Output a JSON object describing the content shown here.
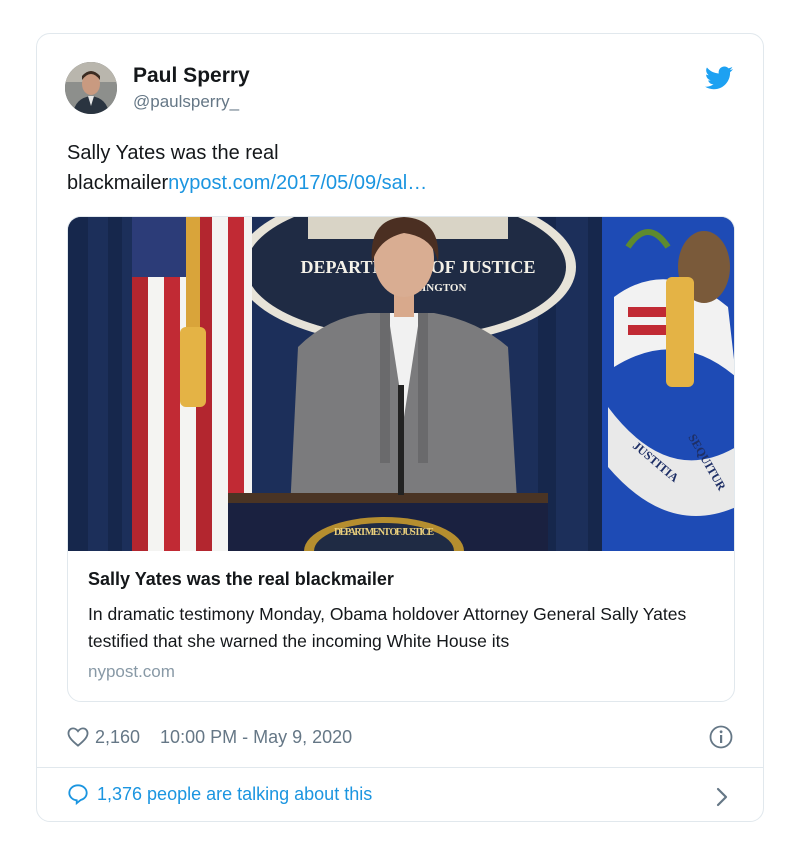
{
  "tweet": {
    "author_name": "Paul Sperry",
    "author_handle": "@paulsperry_",
    "text": "Sally Yates was the real blackmailer",
    "link_text": "nypost.com/2017/05/09/sal…",
    "likes": "2,160",
    "timestamp": "10:00 PM - May 9, 2020",
    "talking": "1,376 people are talking about this"
  },
  "link_card": {
    "title": "Sally Yates was the real blackmailer",
    "description": "In dramatic testimony Monday, Obama holdover Attorney General Sally Yates testified that she warned the incoming White House its",
    "domain": "nypost.com",
    "photo_seal_text": "DEPARTMENT OF JUSTICE",
    "photo_seal_subtext": "WASHINGTON",
    "photo_flag_text_1": "JUSTITIA",
    "photo_flag_text_2": "SEQUITUR",
    "photo_podium_text": "DEPARTMENT OF JUSTICE"
  },
  "icons": {
    "brand": "twitter-bird-icon",
    "like": "heart-icon",
    "info": "info-icon",
    "reply": "speech-bubble-icon",
    "next": "chevron-right-icon"
  },
  "colors": {
    "link": "#1b95e0",
    "muted": "#657786",
    "border": "#e1e8ed"
  }
}
